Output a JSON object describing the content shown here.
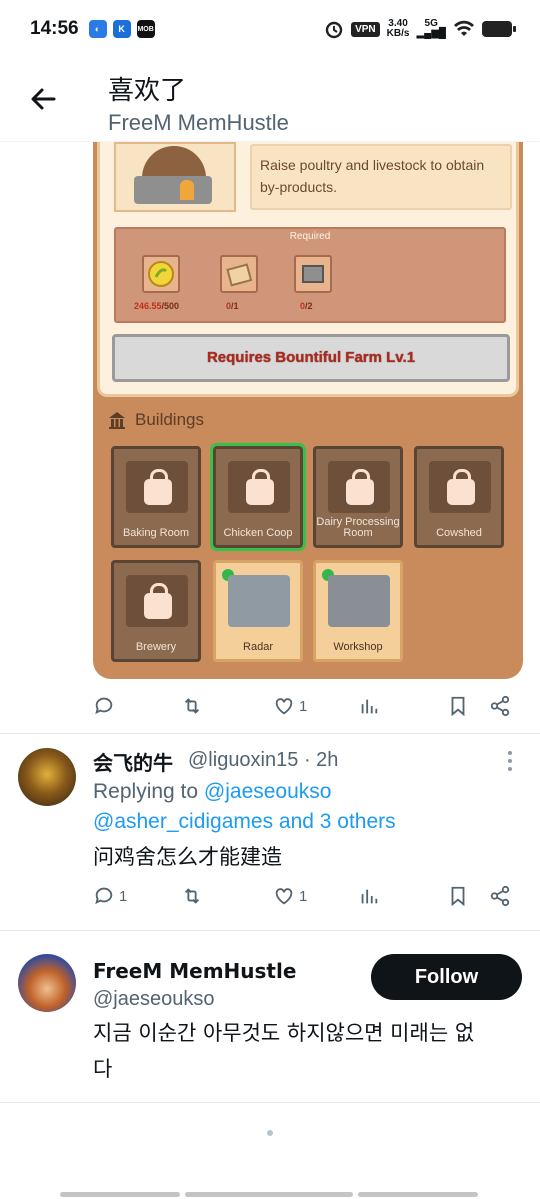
{
  "status_bar": {
    "time": "14:56",
    "vpn": "VPN",
    "speed_value": "3.40",
    "speed_unit": "KB/s",
    "network": "5G",
    "apps": [
      "K",
      "MOB"
    ]
  },
  "header": {
    "title": "喜欢了",
    "subtitle": "FreeM MemHustle"
  },
  "game_card": {
    "description": "Raise poultry and livestock to obtain by-products.",
    "required_label": "Required",
    "requirements": [
      {
        "icon": "coin-icon",
        "have": "246.55",
        "need": "/500"
      },
      {
        "icon": "wood-block-icon",
        "have": "0",
        "need": "/1"
      },
      {
        "icon": "stone-block-icon",
        "have": "0",
        "need": "/2"
      }
    ],
    "requirement_button": "Requires Bountiful Farm Lv.1",
    "buildings_label": "Buildings",
    "buildings": [
      {
        "name": "Baking Room",
        "state": "locked"
      },
      {
        "name": "Chicken Coop",
        "state": "locked-selected"
      },
      {
        "name": "Dairy Processing Room",
        "state": "locked"
      },
      {
        "name": "Cowshed",
        "state": "locked"
      },
      {
        "name": "Brewery",
        "state": "locked"
      },
      {
        "name": "Radar",
        "state": "unlocked"
      },
      {
        "name": "Workshop",
        "state": "unlocked"
      }
    ]
  },
  "tweet1_actions": {
    "reply_count": "",
    "retweet_count": "",
    "like_count": "1"
  },
  "reply_tweet": {
    "name": "会飞的牛",
    "handle": "@liguoxin15",
    "time": "· 2h",
    "replying_prefix": "Replying to",
    "replying_to_1": "@jaeseoukso",
    "replying_to_2": "@asher_cidigames and 3 others",
    "text": "问鸡舍怎么才能建造",
    "reply_count": "1",
    "like_count": "1"
  },
  "author_tweet": {
    "name": "FreeM MemHustle",
    "handle": "@jaeseoukso",
    "follow_label": "Follow",
    "text_line1": "지금 이순간 아무것도 하지않으면  미래는 없",
    "text_line2": "다"
  },
  "colors": {
    "link": "#1d9bf0",
    "secondary_text": "#536471",
    "game_bg": "#c98a5c"
  }
}
